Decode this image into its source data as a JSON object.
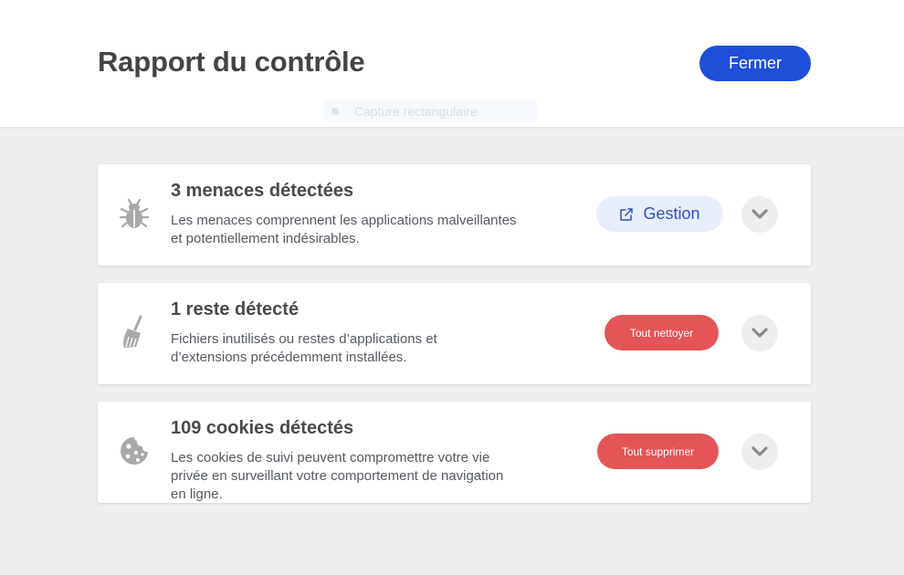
{
  "header": {
    "title": "Rapport du contrôle",
    "close_label": "Fermer"
  },
  "overlay": {
    "label": "Capture rectangulaire"
  },
  "cards": [
    {
      "title": "3 menaces détectées",
      "desc_line1": "Les menaces comprennent les applications malveillantes",
      "desc_line2": "et potentiellement indésirables.",
      "action_label": "Gestion",
      "icon": "bug-icon"
    },
    {
      "title": "1 reste détecté",
      "desc_line1": "Fichiers inutilisés ou restes d’applications et",
      "desc_line2": "d’extensions précédemment installées.",
      "action_label": "Tout nettoyer",
      "icon": "broom-icon"
    },
    {
      "title": "109 cookies détectés",
      "desc_line1": "Les cookies de suivi peuvent compromettre votre vie",
      "desc_line2": "privée en surveillant votre comportement de navigation",
      "desc_line3": "en ligne.",
      "action_label": "Tout supprimer",
      "icon": "cookie-icon"
    }
  ],
  "colors": {
    "primary": "#1e4fd8",
    "danger": "#e35557",
    "background": "#eeeff1"
  }
}
